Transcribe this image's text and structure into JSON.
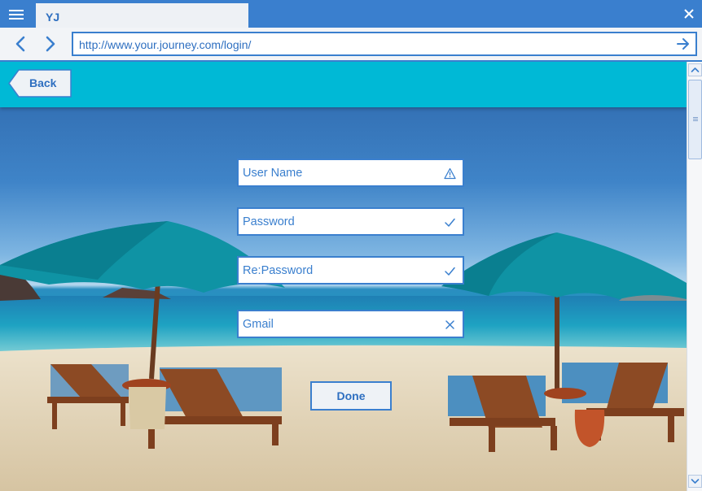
{
  "browser": {
    "tab_title": "YJ",
    "url": "http://www.your.journey.com/login/"
  },
  "page": {
    "back_label": "Back",
    "form": {
      "fields": [
        {
          "placeholder": "User Name",
          "status_icon": "warning-icon",
          "status": "warning"
        },
        {
          "placeholder": "Password",
          "status_icon": "check-icon",
          "status": "valid"
        },
        {
          "placeholder": "Re:Password",
          "status_icon": "check-icon",
          "status": "valid"
        },
        {
          "placeholder": "Gmail",
          "status_icon": "x-icon",
          "status": "invalid"
        }
      ],
      "submit_label": "Done"
    }
  },
  "colors": {
    "chrome_blue": "#3a7fce",
    "header_cyan": "#00b9d6",
    "accent_text": "#2e6fc0"
  }
}
